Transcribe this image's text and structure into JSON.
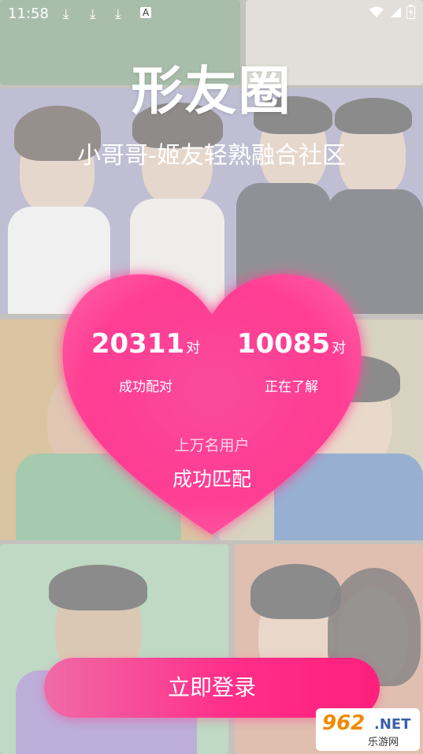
{
  "status_bar": {
    "time": "11:58",
    "download_icons": [
      "download-icon",
      "download-icon",
      "download-icon"
    ],
    "app_icon": "A",
    "wifi_icon": "wifi-icon",
    "signal_icon": "signal-icon",
    "battery_icon": "battery-charging-icon"
  },
  "app": {
    "title": "形友圈",
    "subtitle": "小哥哥-姬友轻熟融合社区"
  },
  "stats": {
    "left": {
      "number": "20311",
      "unit": "对",
      "label": "成功配对"
    },
    "right": {
      "number": "10085",
      "unit": "对",
      "label": "正在了解"
    },
    "users_text": "上万名用户",
    "match_text": "成功匹配"
  },
  "login_button": {
    "label": "立即登录"
  },
  "watermark": {
    "number": "962",
    "suffix": ".NET",
    "text": "乐游网"
  },
  "colors": {
    "heart_pink": "#ff3d93",
    "button_pink": "#ff2f8a"
  }
}
